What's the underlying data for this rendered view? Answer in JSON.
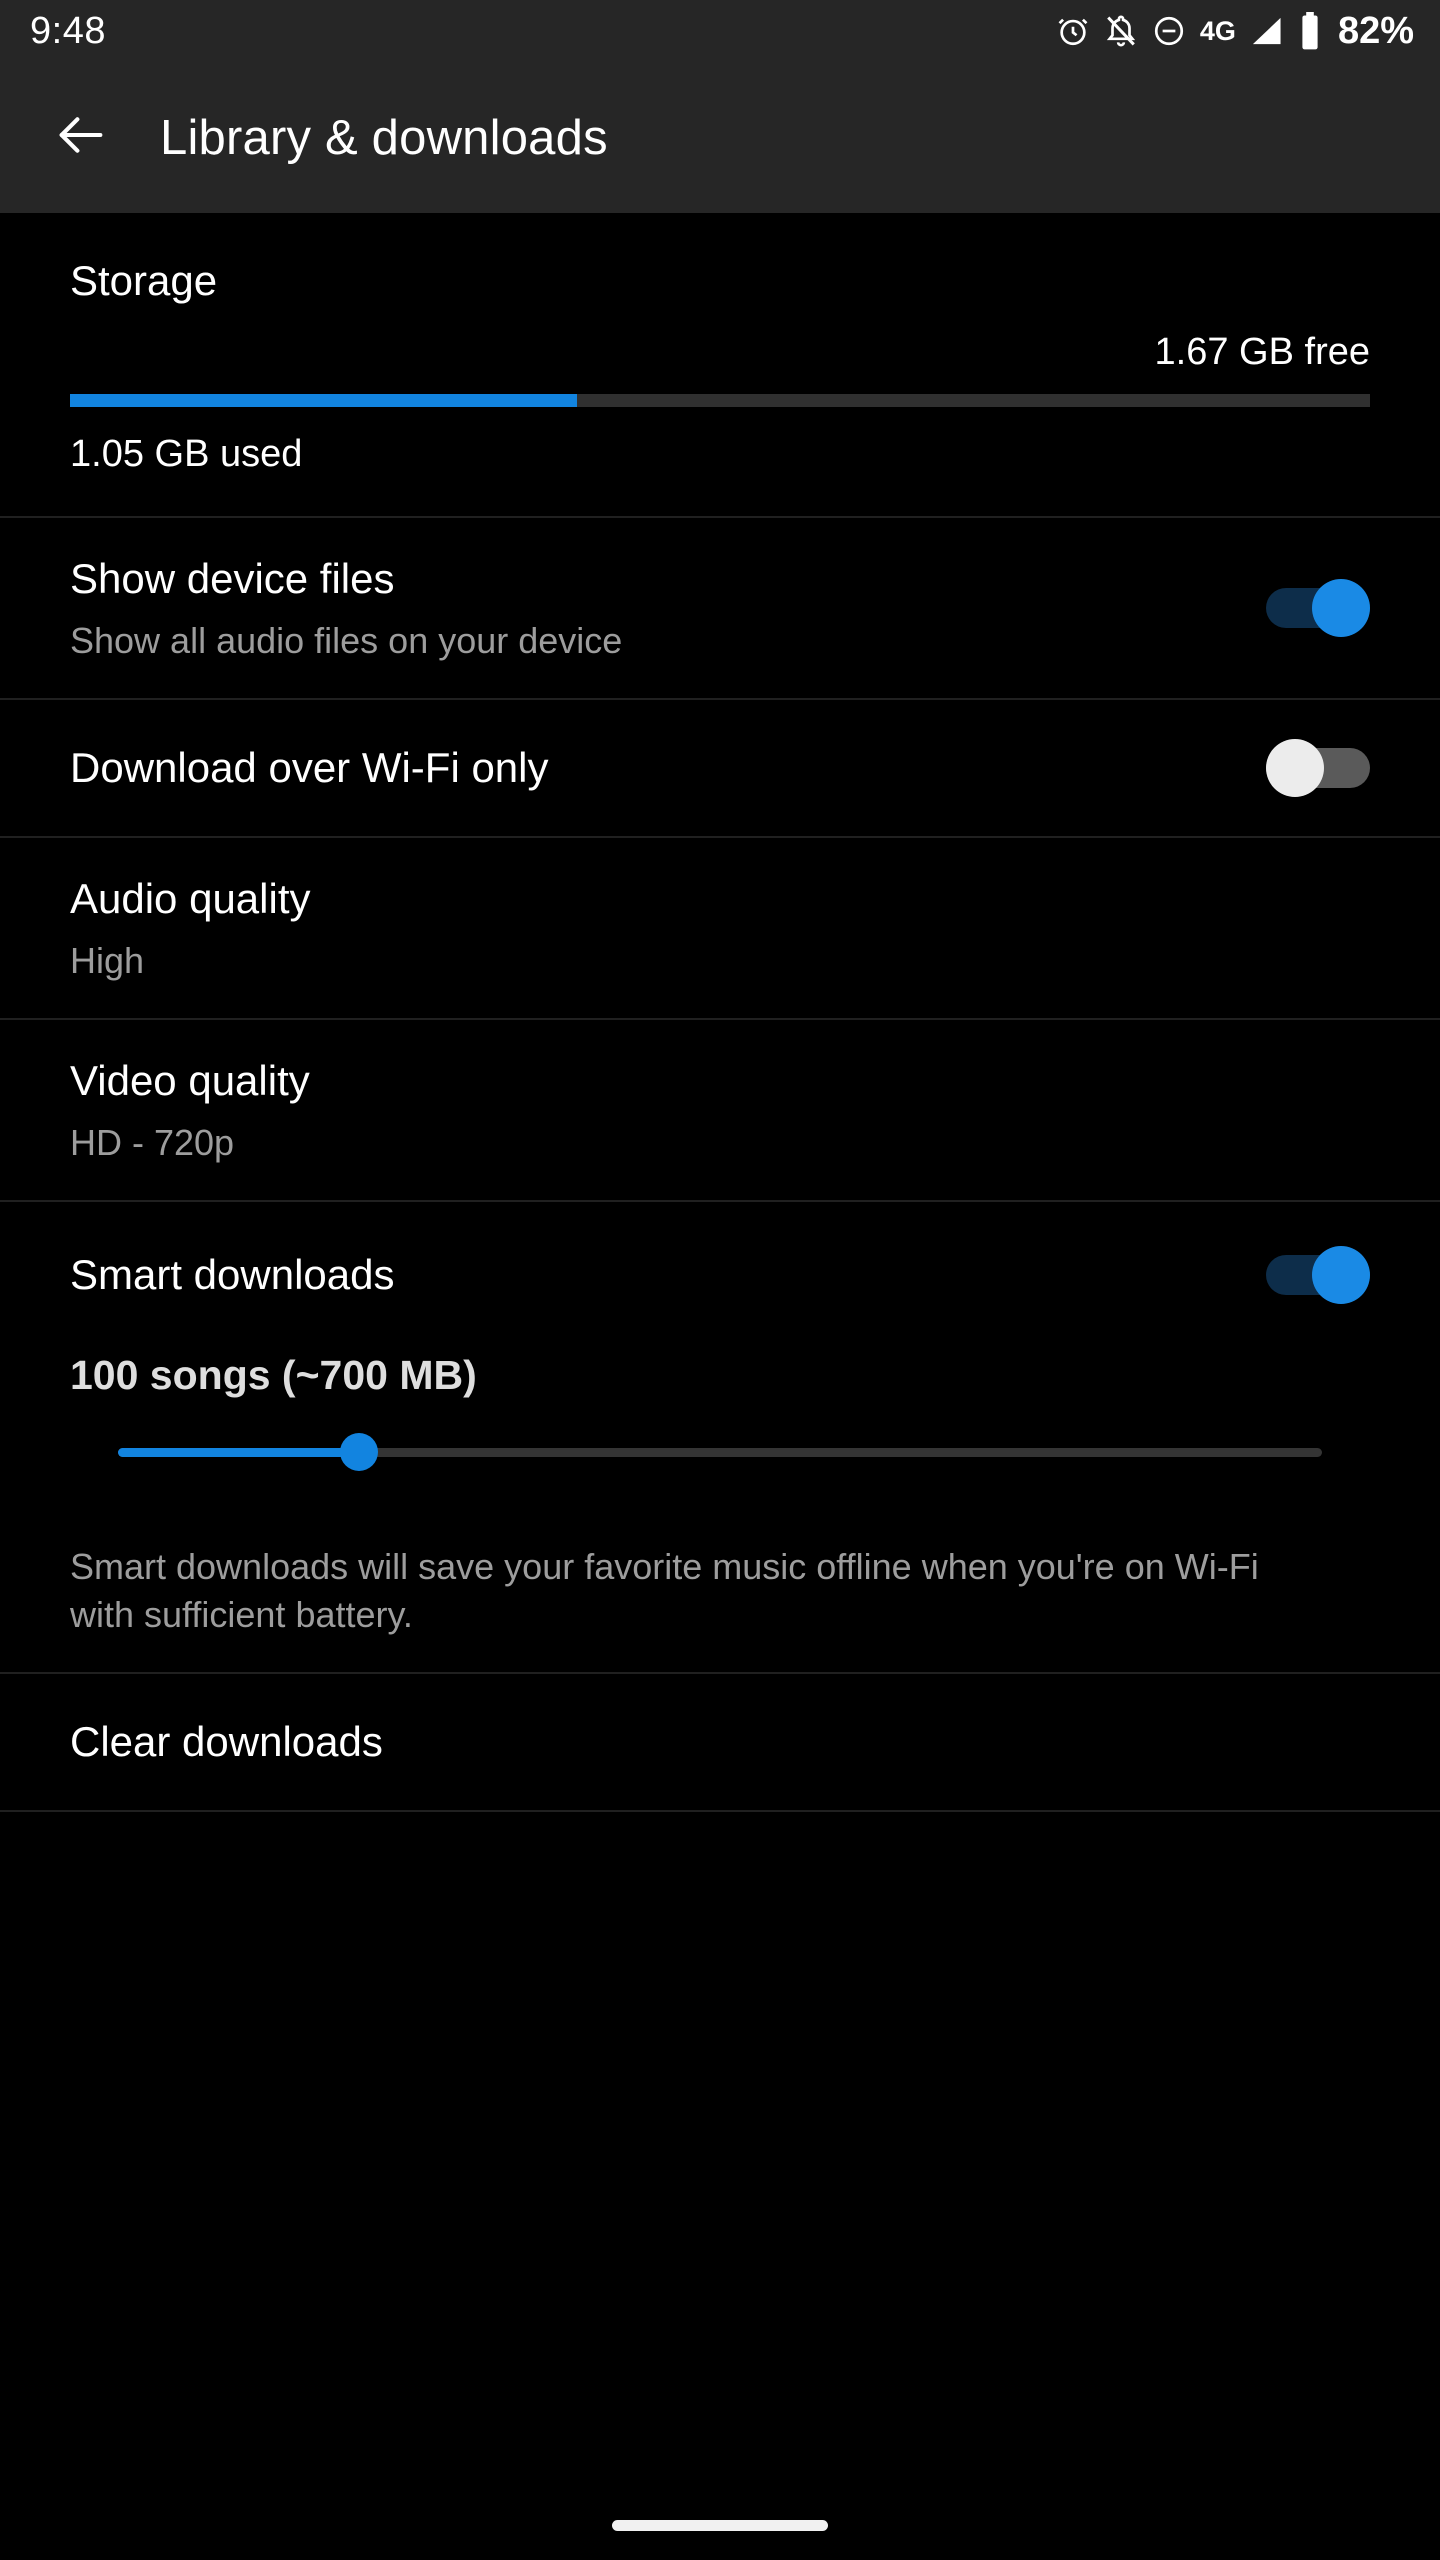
{
  "status_bar": {
    "time": "9:48",
    "network_label": "4G",
    "battery_percent": "82%",
    "icons": [
      "alarm-icon",
      "notifications-off-icon",
      "do-not-disturb-icon",
      "signal-icon",
      "battery-icon"
    ]
  },
  "toolbar": {
    "back_icon": "back-arrow-icon",
    "title": "Library & downloads"
  },
  "storage": {
    "title": "Storage",
    "free_label": "1.67 GB free",
    "used_label": "1.05 GB used",
    "used_percent": 39,
    "fill_color": "#1284e0",
    "track_color": "#303030"
  },
  "settings": [
    {
      "title": "Show device files",
      "subtitle": "Show all audio files on your device",
      "control": "switch",
      "state": "on"
    },
    {
      "title": "Download over Wi-Fi only",
      "subtitle": "",
      "control": "switch",
      "state": "off"
    },
    {
      "title": "Audio quality",
      "subtitle": "High",
      "control": "none",
      "state": ""
    },
    {
      "title": "Video quality",
      "subtitle": "HD - 720p",
      "control": "none",
      "state": ""
    }
  ],
  "smart_downloads": {
    "title": "Smart downloads",
    "state": "on",
    "count_label": "100 songs (~700 MB)",
    "slider_percent": 20,
    "description": "Smart downloads will save your favorite music offline when you're on Wi-Fi with sufficient battery."
  },
  "clear_downloads": {
    "title": "Clear downloads"
  },
  "nav_bar": {
    "handle": "home-gesture-pill"
  },
  "colors": {
    "accent": "#1284e0",
    "toolbar_bg": "#262626",
    "page_bg": "#000000",
    "secondary_text": "#9d9d9d"
  }
}
